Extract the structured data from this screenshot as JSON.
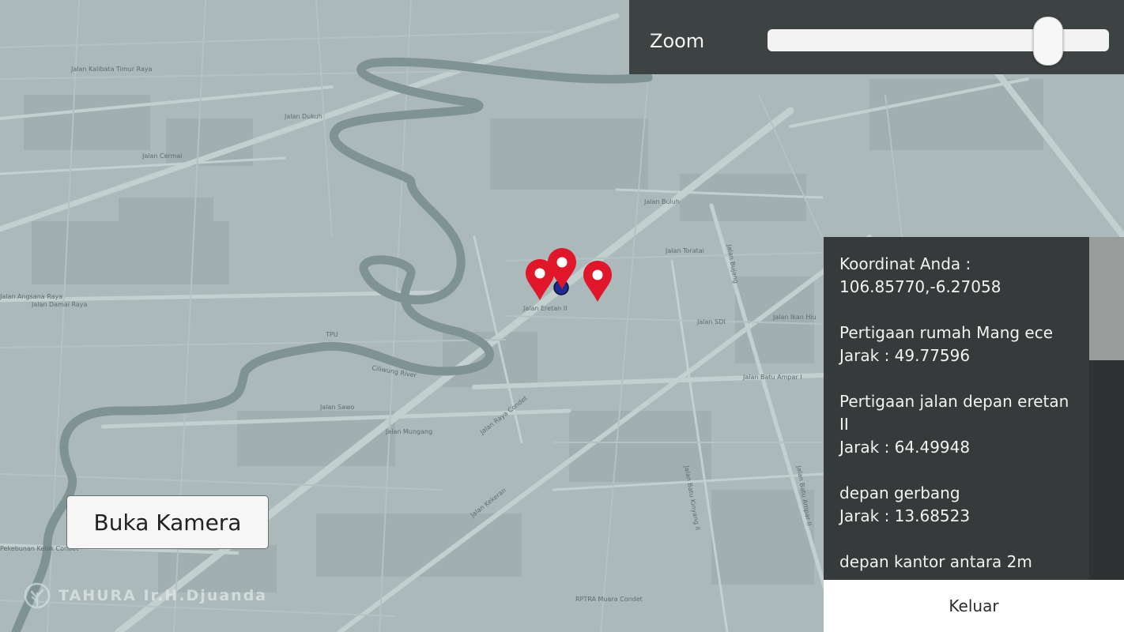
{
  "zoom": {
    "label": "Zoom",
    "level": 0.82
  },
  "map": {
    "street_labels": [
      "Jalan Kalibata Timur Raya",
      "Jalan Cermai",
      "Jalan Angsana Raya",
      "Jalan Damai Raya",
      "Jalan Eretan II",
      "Jalan Sawo",
      "Jalan Mungang",
      "Jalan Raya Condet",
      "Jalan Kekeran",
      "Jalan Batu Ampar I",
      "Jalan Buluh",
      "Jalan Toratai",
      "Jalan SDI",
      "Jalan Ikan Hiu",
      "Ciliwung River",
      "TPU",
      "RPTRA Muara Condet",
      "Jalan Batu Ampar II",
      "Jalan Batu Kinyang II",
      "Jalan Dukuh",
      "Jalan Bujang",
      "Pekebunan Kelak Condet"
    ]
  },
  "info_panel": {
    "lines": [
      "Koordinat Anda :",
      "106.85770,-6.27058",
      "",
      "Pertigaan rumah Mang ece",
      "Jarak : 49.77596",
      "",
      "Pertigaan jalan depan eretan II",
      "Jarak : 64.49948",
      "",
      "depan gerbang",
      "Jarak : 13.68523",
      "",
      "depan kantor antara 2m"
    ]
  },
  "buttons": {
    "exit_label": "Keluar",
    "camera_label": "Buka Kamera"
  },
  "watermark": {
    "text": "TAHURA Ir.H.Djuanda"
  },
  "icons": {
    "marker": "map-pin-icon",
    "user_location": "user-location-icon",
    "logo": "tahura-logo-icon"
  },
  "colors": {
    "marker": "#e0162b",
    "user_dot": "#1d2a8f",
    "panel": "#363a3a",
    "river": "#7f9294"
  }
}
